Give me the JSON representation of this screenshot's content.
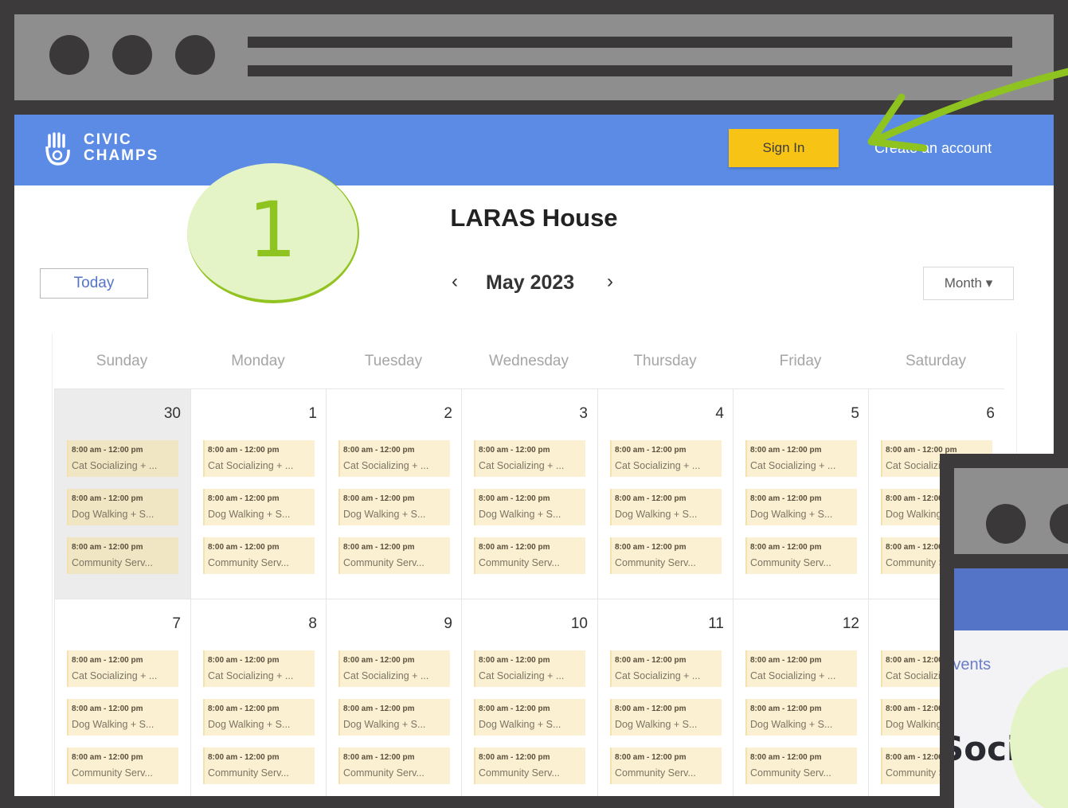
{
  "app": {
    "logo_line1": "CIVIC",
    "logo_line2": "CHAMPS",
    "sign_in_label": "Sign In",
    "create_account_label": "Create an account"
  },
  "page": {
    "title": "LARAS House",
    "today_label": "Today",
    "month_label": "May 2023",
    "prev_icon": "‹",
    "next_icon": "›",
    "view_select": "Month ▾"
  },
  "calendar": {
    "weekdays": [
      "Sunday",
      "Monday",
      "Tuesday",
      "Wednesday",
      "Thursday",
      "Friday",
      "Saturday"
    ],
    "weeks": [
      [
        "30",
        "1",
        "2",
        "3",
        "4",
        "5",
        "6"
      ],
      [
        "7",
        "8",
        "9",
        "10",
        "11",
        "12",
        ""
      ]
    ],
    "event_time": "8:00 am - 12:00 pm",
    "event_names": [
      "Cat Socializing + ...",
      "Dog Walking + S...",
      "Community Serv..."
    ]
  },
  "overlay": {
    "step_number": "1",
    "arrow_color": "#8ec320",
    "badge_color": "#e4f4c6",
    "second_window_link": "Events",
    "second_window_heading": "Social"
  },
  "colors": {
    "navbar": "#5c8be6",
    "sign_in_button": "#f7c415",
    "event_bg": "#fbf1d2",
    "frame": "#3c3a3b"
  }
}
